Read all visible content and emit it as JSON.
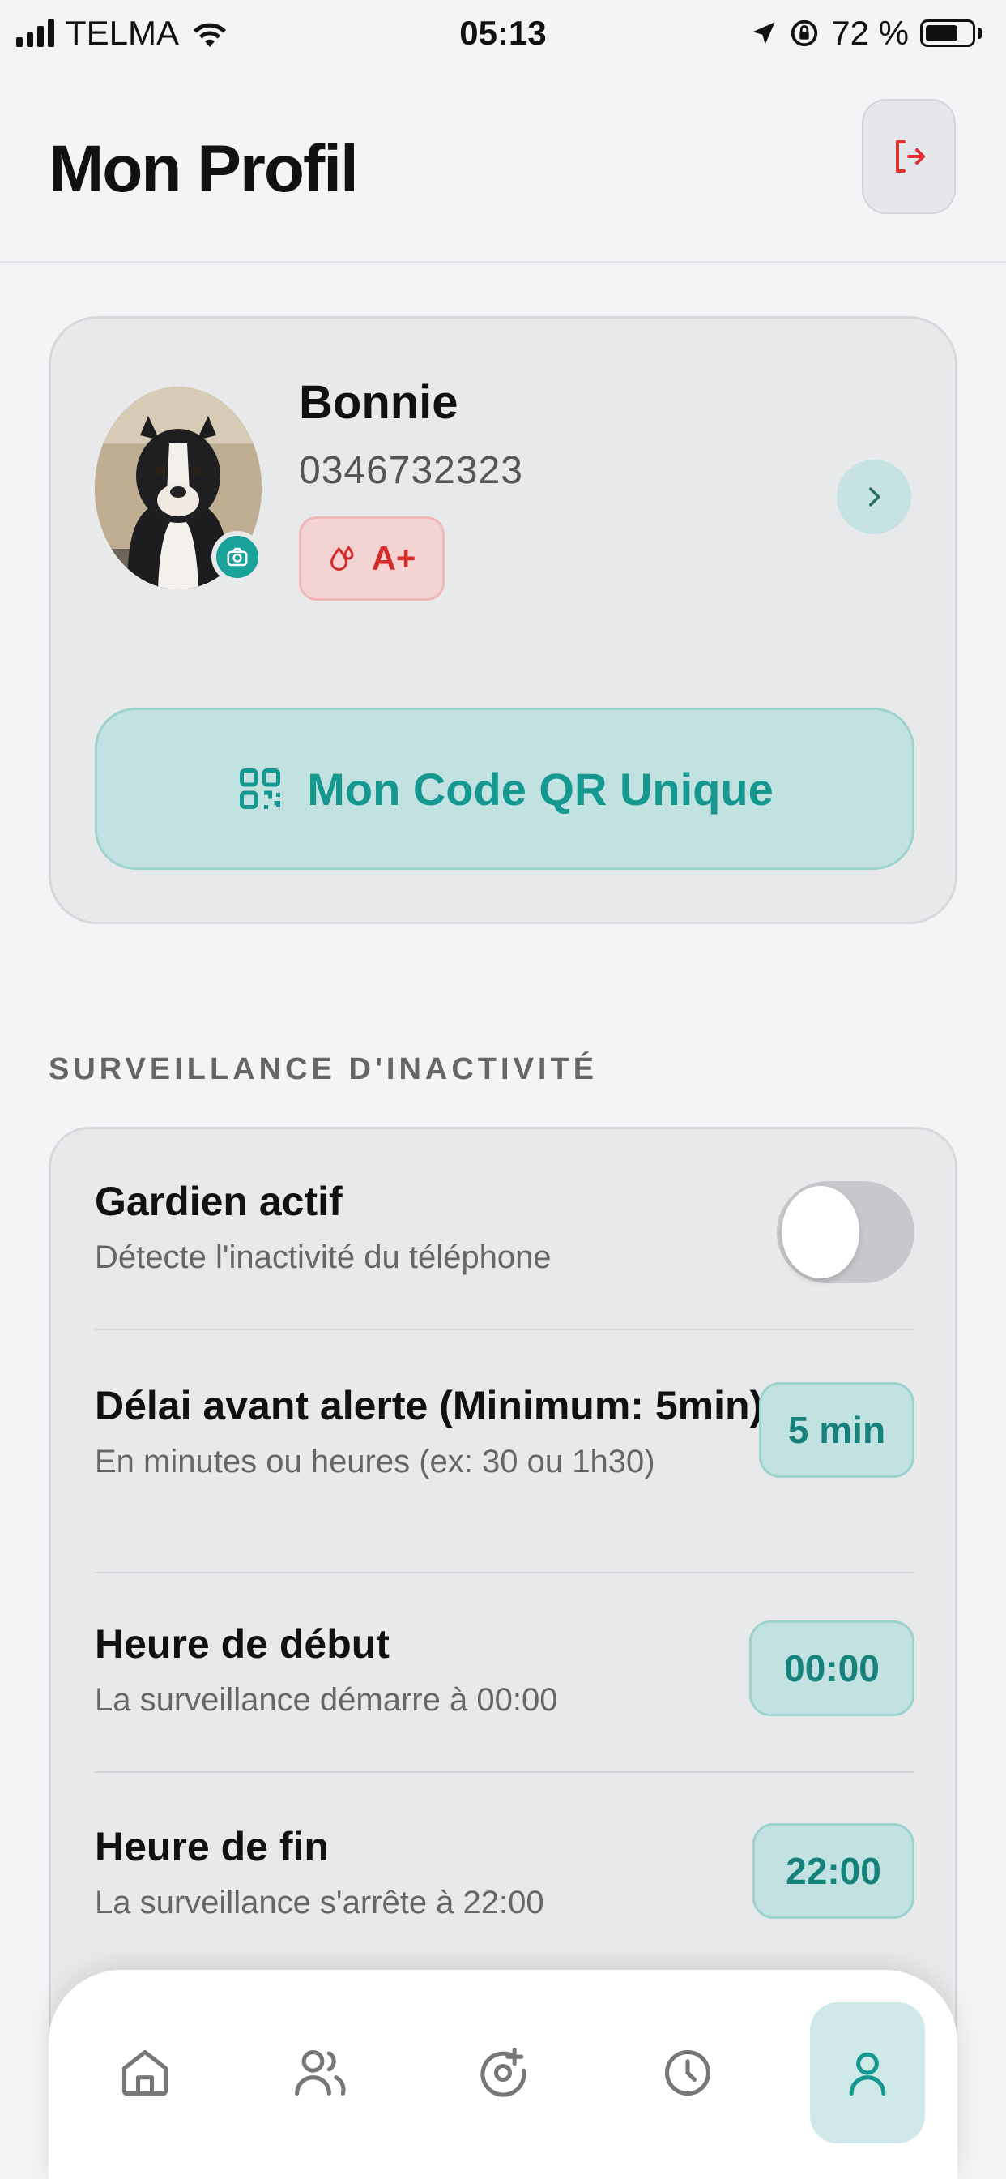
{
  "status_bar": {
    "carrier": "TELMA",
    "time": "05:13",
    "battery": "72 %"
  },
  "header": {
    "title": "Mon Profil"
  },
  "profile": {
    "name": "Bonnie",
    "phone": "0346732323",
    "blood_type": "A+",
    "qr_button_label": "Mon Code QR Unique"
  },
  "monitoring": {
    "section_title": "SURVEILLANCE D'INACTIVITÉ",
    "guardian": {
      "title": "Gardien actif",
      "subtitle": "Détecte l'inactivité du téléphone",
      "enabled": false
    },
    "delay": {
      "title": "Délai avant alerte (Minimum: 5min)",
      "subtitle": "En minutes ou heures (ex: 30 ou 1h30)",
      "value": "5 min"
    },
    "start": {
      "title": "Heure de début",
      "subtitle": "La surveillance démarre à 00:00",
      "value": "00:00"
    },
    "end": {
      "title": "Heure de fin",
      "subtitle": "La surveillance s'arrête à 22:00",
      "value": "22:00"
    }
  },
  "tab_bar": {
    "items": [
      {
        "icon": "home-icon",
        "active": false
      },
      {
        "icon": "contacts-icon",
        "active": false
      },
      {
        "icon": "location-icon",
        "active": false
      },
      {
        "icon": "history-icon",
        "active": false
      },
      {
        "icon": "profile-icon",
        "active": true
      }
    ]
  },
  "colors": {
    "accent": "#159890",
    "danger": "#d42b2b",
    "background": "#f3f4f6"
  }
}
